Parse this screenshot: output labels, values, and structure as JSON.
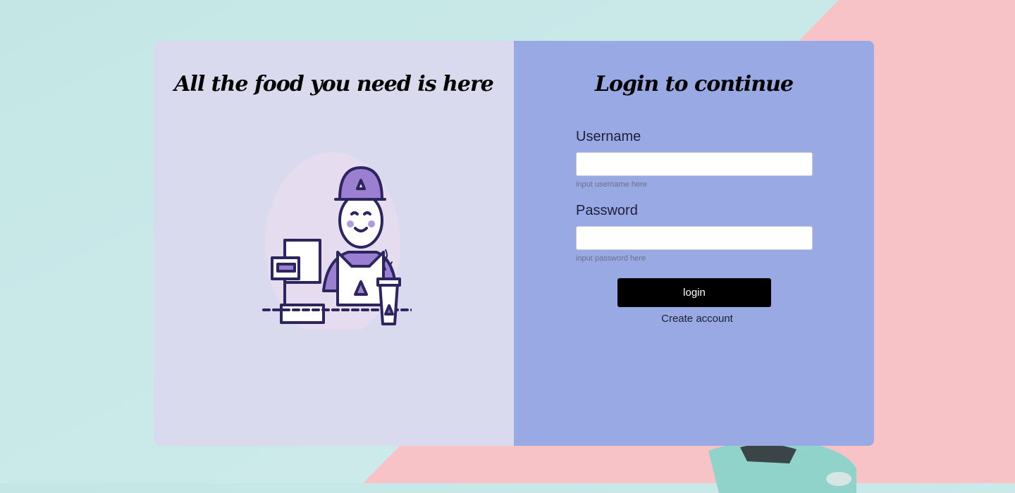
{
  "left_panel": {
    "title": "All the food you need is here"
  },
  "login": {
    "title": "Login to continue",
    "username_label": "Username",
    "username_value": "",
    "username_hint": "input username here",
    "password_label": "Password",
    "password_value": "",
    "password_hint": "input password here",
    "login_button": "login",
    "create_account_link": "Create account"
  },
  "colors": {
    "left_panel": "#d9daed",
    "right_panel": "#99a9e3",
    "accent": "#9b7fd0",
    "button": "#000000"
  }
}
